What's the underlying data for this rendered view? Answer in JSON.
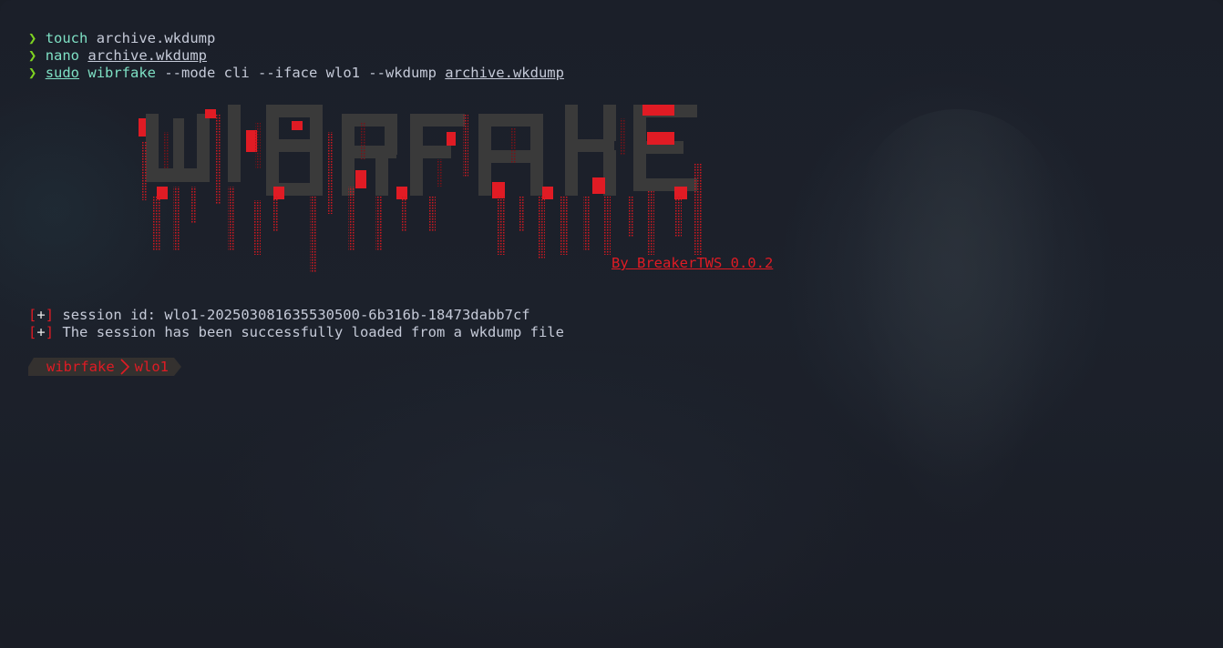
{
  "terminal": {
    "history": [
      {
        "prompt": "❯",
        "cmd": "touch",
        "args": " archive.wkdump"
      },
      {
        "prompt": "❯",
        "cmd": "nano",
        "args_underlined": "archive.wkdump"
      },
      {
        "prompt": "❯",
        "cmd_underlined": "sudo",
        "cmd": "wibrfake",
        "args": " --mode cli --iface wlo1 --wkdump ",
        "args_underlined": "archive.wkdump"
      }
    ],
    "banner": {
      "ascii_word": "WIBRFAKE",
      "colors": {
        "block": "#3a3a3a",
        "blood": "#e01b24",
        "drip": "#8a1016"
      }
    },
    "credit": "By BreakerTWS 0.0.2",
    "messages": [
      {
        "bracket_open": "[",
        "marker": "+",
        "bracket_close": "]",
        "text": " session id: wlo1-202503081635530500-6b316b-18473dabb7cf"
      },
      {
        "bracket_open": "[",
        "marker": "+",
        "bracket_close": "]",
        "text": " The session has been successfully loaded from a wkdump file"
      }
    ],
    "ps1": {
      "app": "wibrfake",
      "separator_icon": "chevron-right-icon",
      "iface": "wlo1"
    }
  },
  "colors": {
    "background": "#1a1e27",
    "prompt": "#7ed321",
    "command": "#7ee0c4",
    "text": "#c5cad8",
    "accent_red": "#e01b24",
    "segment_bg": "#34312f"
  }
}
